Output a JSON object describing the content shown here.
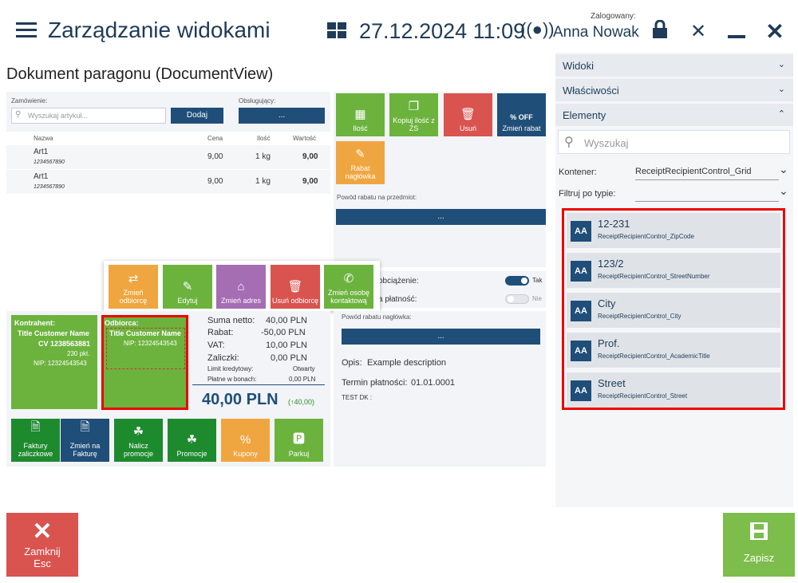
{
  "header": {
    "title": "Zarządzanie widokami",
    "datetime": "27.12.2024 11:09",
    "logged_label": "Zalogowany:",
    "user": "Anna Nowak"
  },
  "doc": {
    "title": "Dokument paragonu (DocumentView)",
    "order_label": "Zamówienie:",
    "search_placeholder": "Wyszukaj artykuł...",
    "add_button": "Dodaj",
    "served_label": "Obsługujący:",
    "served_value": "...",
    "columns": [
      "Nazwa",
      "Cena",
      "Ilość",
      "Wartość"
    ],
    "rows": [
      {
        "name": "Art1",
        "code": "1234567890",
        "price": "9,00",
        "qty": "1 kg",
        "value": "9,00"
      },
      {
        "name": "Art1",
        "code": "1234567890",
        "price": "9,00",
        "qty": "1 kg",
        "value": "9,00"
      }
    ],
    "tiles_top": [
      "Ilość",
      "Kopiuj ilość z ZS",
      "Usuń",
      "Zmień rabat",
      "Rabat nagłówka"
    ],
    "tile_off": "% OFF",
    "item_discount_reason": "Powód rabatu na przedmiot:",
    "item_discount_value": "...",
    "popup_tiles": [
      "Zmień odbiorcę",
      "Edytuj",
      "Zmień adres",
      "Usuń odbiorcę",
      "Zmień osobę kontaktową"
    ],
    "toggle1_label": "obciążenie:",
    "toggle1_value": "Tak",
    "toggle2_label": "a płatność:",
    "toggle2_value": "Nie",
    "contractor": {
      "label": "Kontrahent:",
      "name": "Title Customer Name",
      "cv": "CV 1238563881",
      "points": "230 pkt.",
      "nip": "NIP: 12324543543"
    },
    "recipient": {
      "label": "Odbiorca:",
      "name": "Title Customer Name",
      "nip": "NIP: 12324543543"
    },
    "summary": {
      "net_label": "Suma netto:",
      "net": "40,00 PLN",
      "discount_label": "Rabat:",
      "discount": "-50,00 PLN",
      "vat_label": "VAT:",
      "vat": "10,00 PLN",
      "adv_label": "Zaliczki:",
      "adv": "0,00 PLN",
      "credit_label": "Limit kredytowy:",
      "credit": "Otwarty",
      "vouchers_label": "Płatne w bonach:",
      "vouchers": "0,00 PLN",
      "total": "40,00 PLN",
      "total_change": "(↑40,00)"
    },
    "header_discount_reason": "Powód rabatu nagłówka:",
    "header_discount_value": "...",
    "desc_label": "Opis:",
    "desc": "Example description",
    "due_label": "Termin płatności:",
    "due": "01.01.0001",
    "test_label": "TEST DK :",
    "bottom_tiles": [
      "Faktury zaliczkowe",
      "Zmień na Fakturę",
      "Nalicz promocje",
      "Promocje",
      "Kupony",
      "Parkuj"
    ]
  },
  "right": {
    "views": "Widoki",
    "props": "Właściwości",
    "elements": "Elementy",
    "search_placeholder": "Wyszukaj",
    "container_label": "Kontener:",
    "container_value": "ReceiptRecipientControl_Grid",
    "filter_label": "Filtruj po typie:",
    "items": [
      {
        "title": "12-231",
        "sub": "ReceiptRecipientControl_ZipCode"
      },
      {
        "title": "123/2",
        "sub": "ReceiptRecipientControl_StreetNumber"
      },
      {
        "title": "City",
        "sub": "ReceiptRecipientControl_City"
      },
      {
        "title": "Prof.",
        "sub": "ReceiptRecipientControl_AcademicTitle"
      },
      {
        "title": "Street",
        "sub": "ReceiptRecipientControl_Street"
      }
    ]
  },
  "footer": {
    "close": "Zamknij",
    "close_key": "Esc",
    "save": "Zapisz"
  }
}
